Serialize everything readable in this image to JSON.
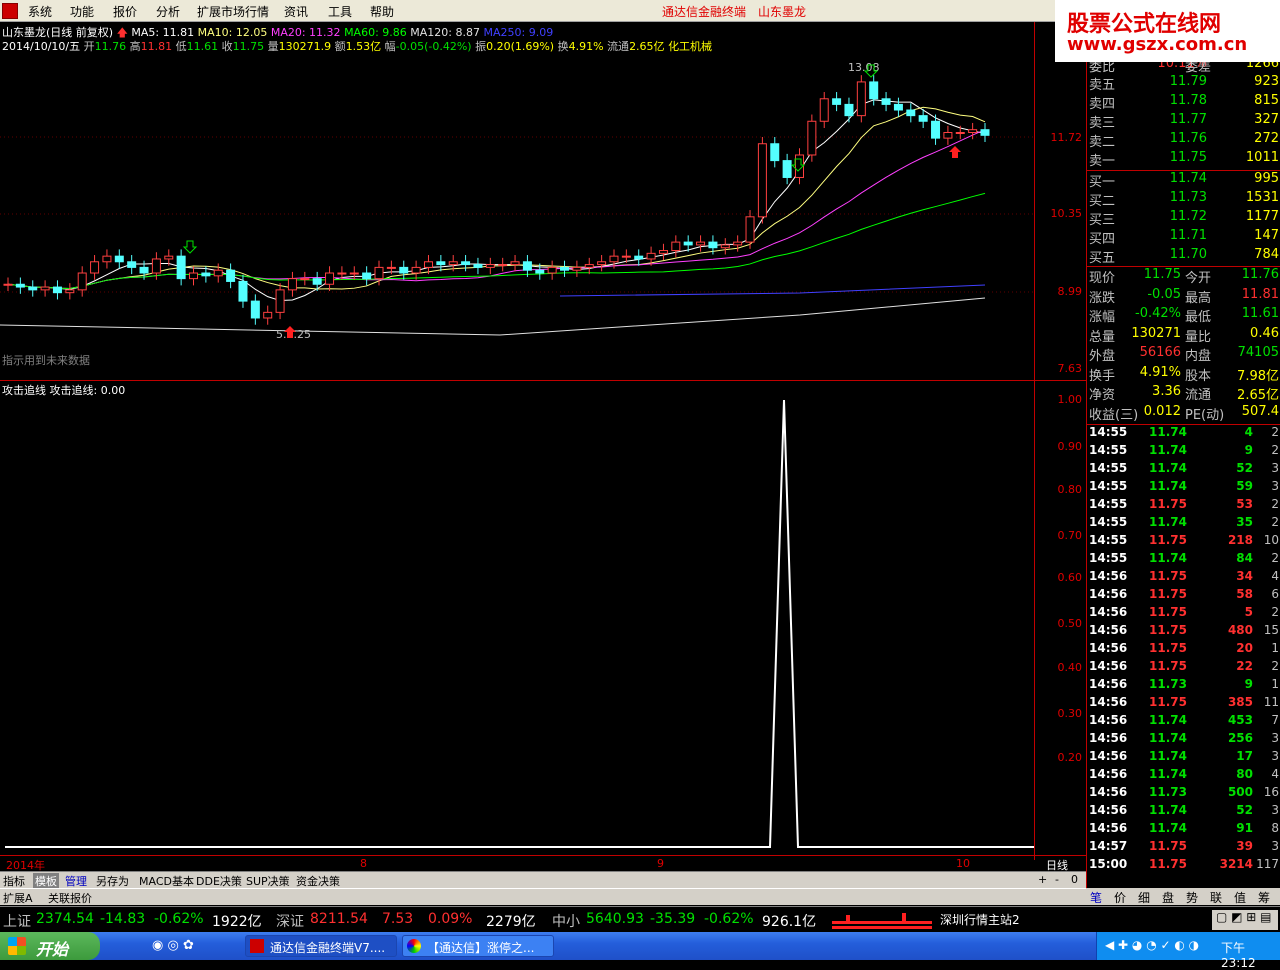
{
  "menu": {
    "items": [
      "系统",
      "功能",
      "报价",
      "分析",
      "扩展市场行情",
      "资讯",
      "工具",
      "帮助"
    ],
    "title_left": "通达信金融终端",
    "title_right": "山东墨龙"
  },
  "brand": {
    "line1": "股票公式在线网",
    "line2": "www.gszx.com.cn"
  },
  "kline": {
    "stock_label": "山东墨龙(日线 前复权)",
    "ma5": "MA5: 11.81",
    "ma10": "MA10: 12.05",
    "ma20": "MA20: 11.32",
    "ma60": "MA60: 9.86",
    "ma120": "MA120: 8.87",
    "ma250": "MA250: 9.09",
    "date": "2014/10/10/五",
    "open_lbl": "开",
    "open": "11.76",
    "high_lbl": "高",
    "high": "11.81",
    "low_lbl": "低",
    "low": "11.61",
    "close_lbl": "收",
    "close": "11.75",
    "vol_lbl": "量",
    "vol": "130271.9",
    "amt_lbl": "额",
    "amt": "1.53亿",
    "chg_lbl": "幅",
    "chg": "-0.05(-0.42%)",
    "amp_lbl": "振",
    "amp": "0.20(1.69%)",
    "turn_lbl": "换",
    "turn": "4.91%",
    "float_lbl": "流通",
    "float": "2.65亿",
    "industry": "化工机械",
    "peak_label": "13.08",
    "low_label": "5.8.25",
    "note": "指示用到未来数据"
  },
  "price_axis": [
    "11.72",
    "10.35",
    "8.99",
    "7.63"
  ],
  "osc": {
    "title": "攻击追线",
    "value": "攻击追线: 0.00",
    "axis": [
      "1.00",
      "0.90",
      "0.80",
      "0.70",
      "0.60",
      "0.50",
      "0.40",
      "0.30",
      "0.20"
    ]
  },
  "time_axis": {
    "labels": [
      "2014年",
      "8",
      "9",
      "10"
    ],
    "period": "日线"
  },
  "tabs": [
    "指标",
    "模板",
    "管理",
    "另存为",
    "MACD基本",
    "DDE决策",
    "SUP决策",
    "资金决策"
  ],
  "tabs2": [
    "扩展A",
    "关联报价"
  ],
  "quote": {
    "weibi_lbl": "委比",
    "weibi": "10.11%",
    "weicha_lbl": "委差",
    "weicha": "1266",
    "asks": [
      {
        "label": "卖五",
        "price": "11.79",
        "vol": "923"
      },
      {
        "label": "卖四",
        "price": "11.78",
        "vol": "815"
      },
      {
        "label": "卖三",
        "price": "11.77",
        "vol": "327"
      },
      {
        "label": "卖二",
        "price": "11.76",
        "vol": "272"
      },
      {
        "label": "卖一",
        "price": "11.75",
        "vol": "1011"
      }
    ],
    "bids": [
      {
        "label": "买一",
        "price": "11.74",
        "vol": "995"
      },
      {
        "label": "买二",
        "price": "11.73",
        "vol": "1531"
      },
      {
        "label": "买三",
        "price": "11.72",
        "vol": "1177"
      },
      {
        "label": "买四",
        "price": "11.71",
        "vol": "147"
      },
      {
        "label": "买五",
        "price": "11.70",
        "vol": "784"
      }
    ],
    "stats": [
      {
        "l1": "现价",
        "v1": "11.75",
        "c1": "#00e000",
        "l2": "今开",
        "v2": "11.76",
        "c2": "#00e000"
      },
      {
        "l1": "涨跌",
        "v1": "-0.05",
        "c1": "#00e000",
        "l2": "最高",
        "v2": "11.81",
        "c2": "#ff3030"
      },
      {
        "l1": "涨幅",
        "v1": "-0.42%",
        "c1": "#00e000",
        "l2": "最低",
        "v2": "11.61",
        "c2": "#00e000"
      },
      {
        "l1": "总量",
        "v1": "130271",
        "c1": "#ffff00",
        "l2": "量比",
        "v2": "0.46",
        "c2": "#ffff00"
      },
      {
        "l1": "外盘",
        "v1": "56166",
        "c1": "#ff3030",
        "l2": "内盘",
        "v2": "74105",
        "c2": "#00e000"
      },
      {
        "l1": "换手",
        "v1": "4.91%",
        "c1": "#ffff00",
        "l2": "股本",
        "v2": "7.98亿",
        "c2": "#ffff00"
      },
      {
        "l1": "净资",
        "v1": "3.36",
        "c1": "#ffff00",
        "l2": "流通",
        "v2": "2.65亿",
        "c2": "#ffff00"
      },
      {
        "l1": "收益(三)",
        "v1": "0.012",
        "c1": "#ffff00",
        "l2": "PE(动)",
        "v2": "507.4",
        "c2": "#ffff00"
      }
    ],
    "ticks": [
      [
        "14:55",
        "11.74",
        "4",
        "2"
      ],
      [
        "14:55",
        "11.74",
        "9",
        "2"
      ],
      [
        "14:55",
        "11.74",
        "52",
        "3"
      ],
      [
        "14:55",
        "11.74",
        "59",
        "3"
      ],
      [
        "14:55",
        "11.75",
        "53",
        "2"
      ],
      [
        "14:55",
        "11.74",
        "35",
        "2"
      ],
      [
        "14:55",
        "11.75",
        "218",
        "10"
      ],
      [
        "14:55",
        "11.74",
        "84",
        "2"
      ],
      [
        "14:56",
        "11.75",
        "34",
        "4"
      ],
      [
        "14:56",
        "11.75",
        "58",
        "6"
      ],
      [
        "14:56",
        "11.75",
        "5",
        "2"
      ],
      [
        "14:56",
        "11.75",
        "480",
        "15"
      ],
      [
        "14:56",
        "11.75",
        "20",
        "1"
      ],
      [
        "14:56",
        "11.75",
        "22",
        "2"
      ],
      [
        "14:56",
        "11.73",
        "9",
        "1"
      ],
      [
        "14:56",
        "11.75",
        "385",
        "11"
      ],
      [
        "14:56",
        "11.74",
        "453",
        "7"
      ],
      [
        "14:56",
        "11.74",
        "256",
        "3"
      ],
      [
        "14:56",
        "11.74",
        "17",
        "3"
      ],
      [
        "14:56",
        "11.74",
        "80",
        "4"
      ],
      [
        "14:56",
        "11.73",
        "500",
        "16"
      ],
      [
        "14:56",
        "11.74",
        "52",
        "3"
      ],
      [
        "14:56",
        "11.74",
        "91",
        "8"
      ],
      [
        "14:57",
        "11.75",
        "39",
        "3"
      ],
      [
        "15:00",
        "11.75",
        "3214",
        "117"
      ]
    ]
  },
  "right_tabs": [
    "笔",
    "价",
    "细",
    "盘",
    "势",
    "联",
    "值",
    "筹"
  ],
  "status": {
    "sh_lbl": "上证",
    "sh": "2374.54",
    "sh_chg": "-14.83",
    "sh_pct": "-0.62%",
    "sh_amt": "1922亿",
    "sz_lbl": "深证",
    "sz": "8211.54",
    "sz_chg": "7.53",
    "sz_pct": "0.09%",
    "sz_amt": "2279亿",
    "zx_lbl": "中小",
    "zx": "5640.93",
    "zx_chg": "-35.39",
    "zx_pct": "-0.62%",
    "zx_amt": "926.1亿",
    "server": "深圳行情主站2"
  },
  "taskbar": {
    "start": "开始",
    "task1": "通达信金融终端V7....",
    "task2": "【通达信】涨停之...",
    "clock": "下午 23:12"
  }
}
